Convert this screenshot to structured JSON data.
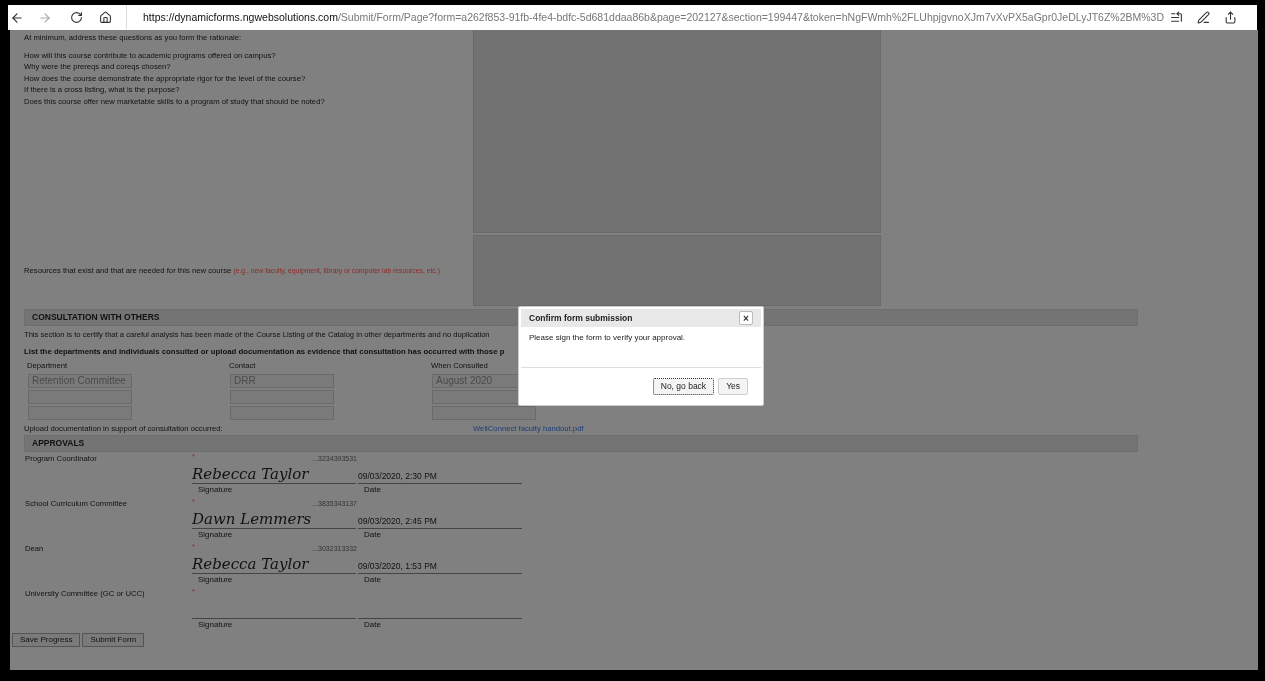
{
  "browser": {
    "url_host": "https://dynamicforms.ngwebsolutions.com",
    "url_path": "/Submit/Form/Page?form=a262f853-91fb-4fe4-bdfc-5d681ddaa86b&page=202127&section=199447&token=hNgFWmh%2FLUhpjgvnoXJm7vXvPX5aGpr0JeDLyJT6Z%2BM%3D"
  },
  "rationale": {
    "intro": "At minimum, address these questions as you form the rationale:",
    "questions": [
      "How will this course contribute to academic programs offered on campus?",
      "Why were the prereqs and coreqs chosen?",
      "How does the course demonstrate the appropriate rigor for the level of the course?",
      "If there is a cross listing, what is the purpose?",
      "Does this course offer new marketable skills to a program of study that should be noted?"
    ]
  },
  "resources": {
    "label": "Resources that exist and that are needed for this new course",
    "hint": "(e.g., new faculty, equipment, library or computer lab resources, etc.)"
  },
  "consultation": {
    "heading": "CONSULTATION WITH OTHERS",
    "note": "This section is to certify that a careful analysis has been made of the Course Listing of the Catalog in other departments and no duplication",
    "instruction": "List the departments and individuals consulted or upload documentation as evidence that consultation has occurred with those p",
    "columns": [
      "Department",
      "Contact",
      "When Consulted"
    ],
    "rows": [
      [
        "Retention Committee",
        "DRR",
        "August 2020"
      ],
      [
        "",
        "",
        ""
      ],
      [
        "",
        "",
        ""
      ]
    ],
    "upload_label": "Upload documentation in support of consultation occurred:",
    "upload_file": "WellConnect faculty handout.pdf"
  },
  "approvals": {
    "heading": "APPROVALS",
    "items": [
      {
        "role": "Program Coordinator",
        "required_mark": "*",
        "sig_id": "...3234393531",
        "signature": "Rebecca Taylor",
        "date": "09/03/2020, 2:30 PM",
        "sig_label": "Signature",
        "date_label": "Date"
      },
      {
        "role": "School Curriculum Committee",
        "required_mark": "*",
        "sig_id": "...3835343137",
        "signature": "Dawn Lemmers",
        "date": "09/03/2020, 2:45 PM",
        "sig_label": "Signature",
        "date_label": "Date"
      },
      {
        "role": "Dean",
        "required_mark": "*",
        "sig_id": "...3032313332",
        "signature": "Rebecca Taylor",
        "date": "09/03/2020, 1:53 PM",
        "sig_label": "Signature",
        "date_label": "Date"
      },
      {
        "role": "University Committee (GC or UCC)",
        "required_mark": "*",
        "sig_label": "Signature",
        "date_label": "Date"
      }
    ]
  },
  "footer_buttons": [
    "Save Progress",
    "Submit Form"
  ],
  "dialog": {
    "title": "Confirm form submission",
    "close": "×",
    "message": "Please sign the form to verify your approval.",
    "buttons": [
      {
        "label": "No, go back",
        "focused": true
      },
      {
        "label": "Yes",
        "focused": false
      }
    ]
  }
}
